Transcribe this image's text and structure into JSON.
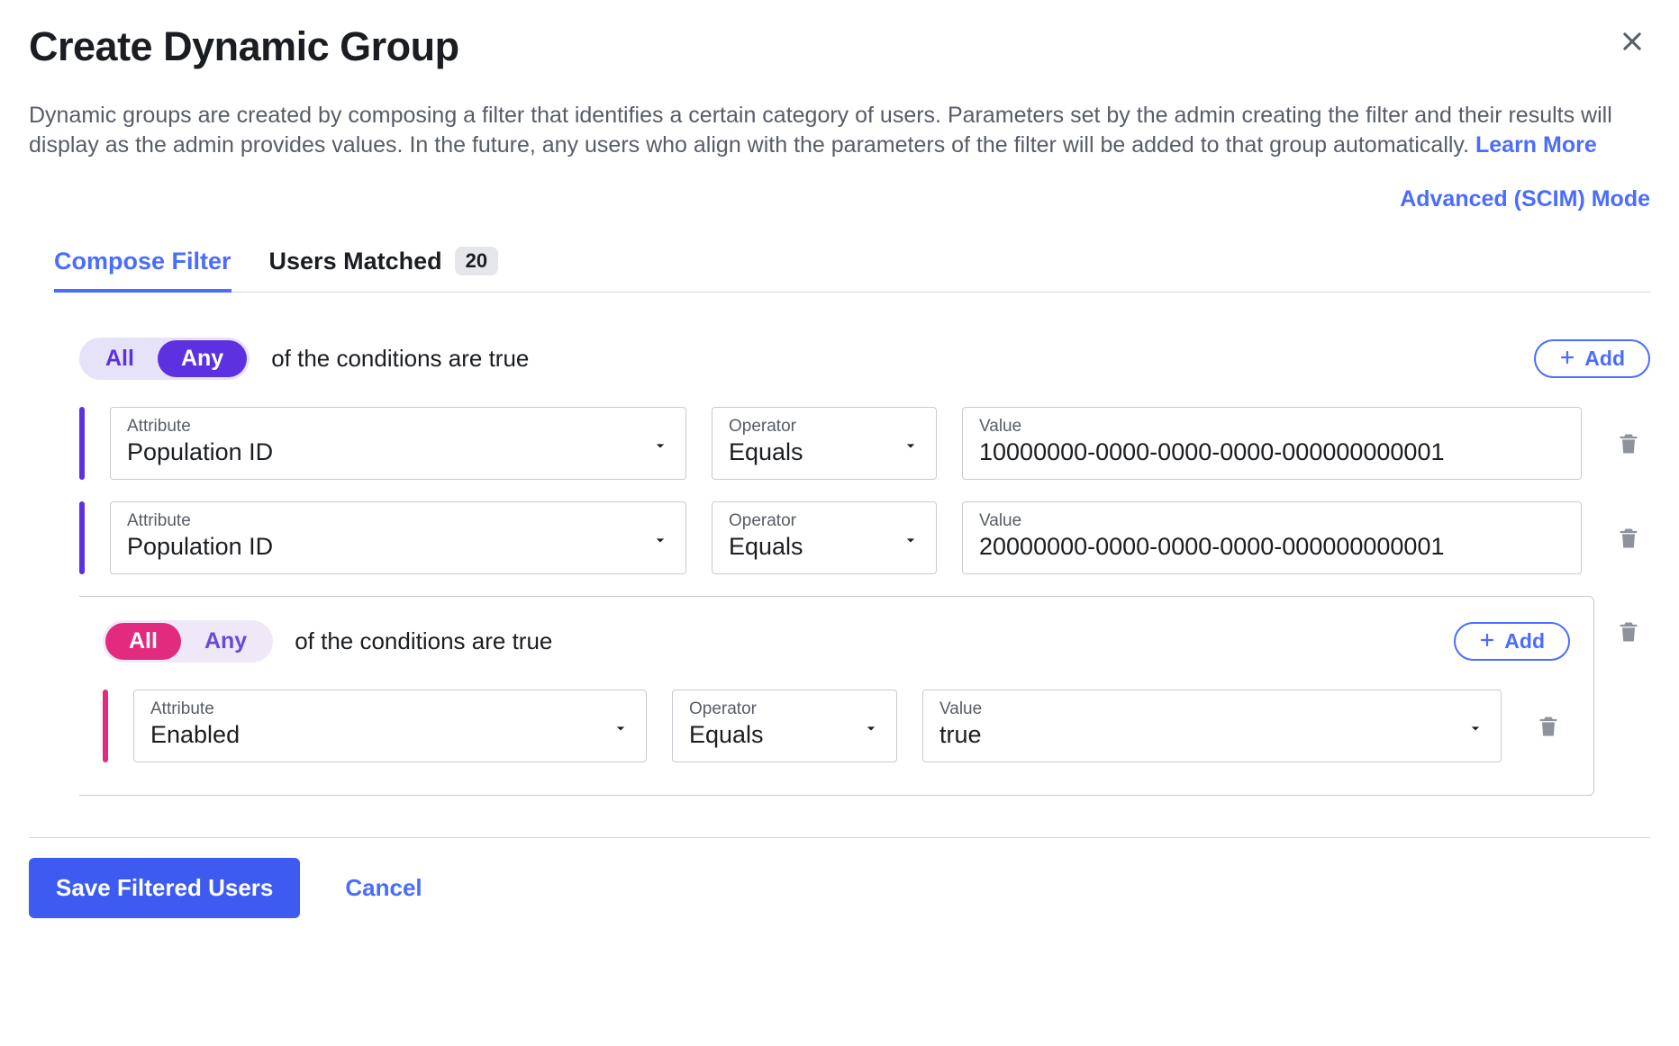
{
  "dialog": {
    "title": "Create Dynamic Group",
    "description_prefix": "Dynamic groups are created by composing a filter that identifies a certain category of users. Parameters set by the admin creating the filter and their results will display as the admin provides values. In the future, any users who align with the parameters of the filter will be added to that group automatically. ",
    "learn_more_label": "Learn More",
    "scim_label": "Advanced (SCIM) Mode"
  },
  "tabs": {
    "compose_label": "Compose Filter",
    "matched_label": "Users Matched",
    "matched_count": "20"
  },
  "labels": {
    "attribute": "Attribute",
    "operator": "Operator",
    "value": "Value",
    "conditions_text": "of the conditions are true",
    "all": "All",
    "any": "Any",
    "add": "Add"
  },
  "group": {
    "selected": "Any",
    "rows": [
      {
        "attribute": "Population ID",
        "operator": "Equals",
        "value": "10000000-0000-0000-0000-000000000001"
      },
      {
        "attribute": "Population ID",
        "operator": "Equals",
        "value": "20000000-0000-0000-0000-000000000001"
      }
    ],
    "nested": {
      "selected": "All",
      "rows": [
        {
          "attribute": "Enabled",
          "operator": "Equals",
          "value": "true"
        }
      ]
    }
  },
  "footer": {
    "save_label": "Save Filtered Users",
    "cancel_label": "Cancel"
  }
}
